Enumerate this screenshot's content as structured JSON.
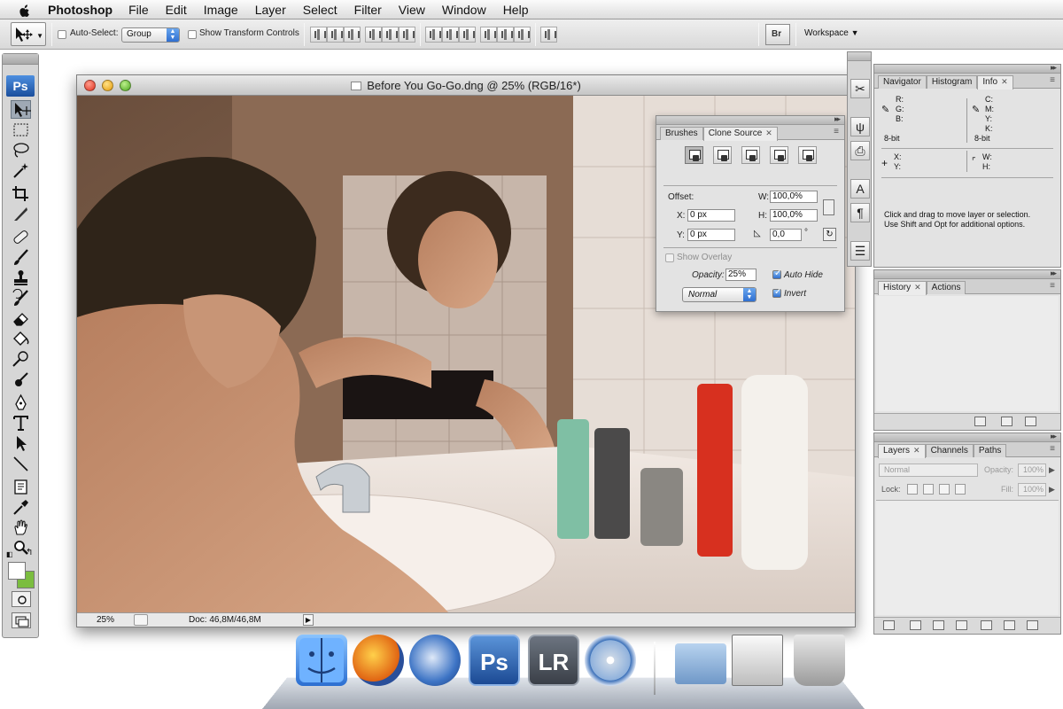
{
  "menubar": {
    "app_name": "Photoshop",
    "items": [
      "File",
      "Edit",
      "Image",
      "Layer",
      "Select",
      "Filter",
      "View",
      "Window",
      "Help"
    ]
  },
  "options": {
    "auto_select_label": "Auto-Select:",
    "auto_select_value": "Group",
    "show_transform_label": "Show Transform Controls",
    "workspace_label": "Workspace"
  },
  "tools": {
    "logo": "Ps"
  },
  "document": {
    "title": "Before You Go-Go.dng @ 25% (RGB/16*)",
    "zoom": "25%",
    "doc_size": "Doc: 46,8M/46,8M"
  },
  "clone_source": {
    "tabs": [
      "Brushes",
      "Clone Source"
    ],
    "offset_label": "Offset:",
    "x_label": "X:",
    "x_value": "0 px",
    "y_label": "Y:",
    "y_value": "0 px",
    "w_label": "W:",
    "w_value": "100,0%",
    "h_label": "H:",
    "h_value": "100,0%",
    "angle_value": "0,0",
    "angle_unit": "°",
    "show_overlay": "Show Overlay",
    "opacity_label": "Opacity:",
    "opacity_value": "25%",
    "auto_hide": "Auto Hide",
    "invert": "Invert",
    "blend_mode": "Normal"
  },
  "info": {
    "tabs": [
      "Navigator",
      "Histogram",
      "Info"
    ],
    "rgb_labels": "R:\nG:\nB:",
    "cmyk_labels": "C:\nM:\nY:\nK:",
    "bit_depth_1": "8-bit",
    "bit_depth_2": "8-bit",
    "xy_labels": "X:\nY:",
    "wh_labels": "W:\nH:",
    "hint_line1": "Click and drag to move layer or selection.",
    "hint_line2": "Use Shift and Opt for additional options."
  },
  "history": {
    "tabs": [
      "History",
      "Actions"
    ]
  },
  "layers": {
    "tabs": [
      "Layers",
      "Channels",
      "Paths"
    ],
    "blend_mode": "Normal",
    "opacity_label": "Opacity:",
    "opacity_value": "100%",
    "lock_label": "Lock:",
    "fill_label": "Fill:",
    "fill_value": "100%"
  },
  "dock": {
    "ps_label": "Ps",
    "lr_label": "LR"
  },
  "colors": {
    "accent_blue": "#2f6fd0",
    "background_swatch": "#7bbd3f",
    "foreground_swatch": "#ffffff"
  }
}
